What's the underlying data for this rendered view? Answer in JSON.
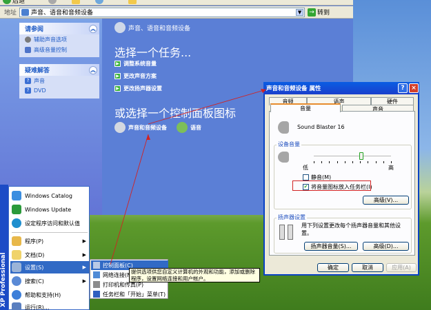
{
  "explorer": {
    "toolbar": {
      "back_label": "后退"
    },
    "address": {
      "label": "地址",
      "value": "声音、语音和音频设备",
      "go_label": "转到"
    },
    "left_pane": {
      "see_also": {
        "title": "请参阅",
        "items": [
          "辅助声音选项",
          "高级音量控制"
        ]
      },
      "troubleshoot": {
        "title": "疑难解答",
        "items": [
          "声音",
          "DVD"
        ]
      }
    },
    "main": {
      "category_title": "声音、语音和音频设备",
      "task_heading": "选择一个任务...",
      "tasks": [
        "调整系统音量",
        "更改声音方案",
        "更改扬声器设置"
      ],
      "or_heading": "或选择一个控制面板图标",
      "icons": [
        "声音和音频设备",
        "语音"
      ]
    }
  },
  "start_menu": {
    "side_label": "XP Professional",
    "pinned": [
      "Windows Catalog",
      "Windows Update",
      "设定程序访问和默认值"
    ],
    "items": [
      {
        "label": "程序(P)",
        "submenu": true
      },
      {
        "label": "文档(D)",
        "submenu": true
      },
      {
        "label": "设置(S)",
        "submenu": true
      },
      {
        "label": "搜索(C)",
        "submenu": true
      },
      {
        "label": "帮助和支持(H)",
        "submenu": false
      },
      {
        "label": "运行(R)...",
        "submenu": false
      }
    ],
    "settings_submenu": [
      "控制面板(C)",
      "网络连接(N)",
      "打印机和传真(P)",
      "任务栏和「开始」菜单(T)"
    ],
    "tooltip": "提供选项供您自定义计算机的外观和功能，添加或删除程序，设置网络连接和用户帐户。"
  },
  "dialog": {
    "title": "声音和音频设备 属性",
    "tabs_back": [
      "音频",
      "语声",
      "硬件"
    ],
    "tabs_front": [
      "音量",
      "声音"
    ],
    "device_name": "Sound Blaster 16",
    "volume_group": "设备音量",
    "low_label": "低",
    "high_label": "高",
    "mute_label": "静音(M)",
    "mute_checked": false,
    "tray_label": "将音量图标放入任务栏(I)",
    "tray_checked": true,
    "volume_level": 0.62,
    "advanced_label": "高级(V)...",
    "speaker_group": "扬声器设置",
    "speaker_desc": "用下列设置更改每个扬声器音量和其他设置。",
    "speaker_volume_button": "扬声器音量(S)...",
    "speaker_advanced_button": "高级(D)...",
    "ok_label": "确定",
    "cancel_label": "取消",
    "apply_label": "应用(A)"
  },
  "colors": {
    "accent": "#316ac5",
    "annotation": "#d12222"
  }
}
